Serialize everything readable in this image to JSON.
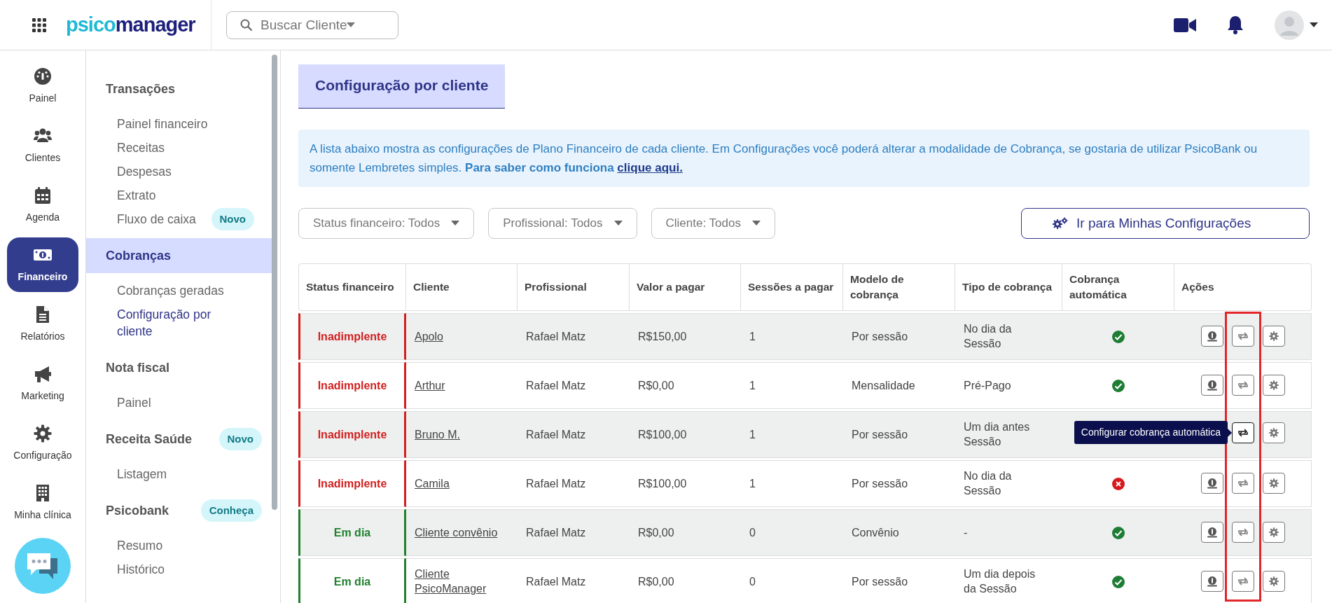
{
  "topbar": {
    "logo": [
      "psico",
      "manager"
    ],
    "search": {
      "placeholder": "Buscar Cliente"
    }
  },
  "rail": [
    {
      "label": "Painel",
      "selected": false
    },
    {
      "label": "Clientes",
      "selected": false
    },
    {
      "label": "Agenda",
      "selected": false
    },
    {
      "label": "Financeiro",
      "selected": true
    },
    {
      "label": "Relatórios",
      "selected": false
    },
    {
      "label": "Marketing",
      "selected": false
    },
    {
      "label": "Configuração",
      "selected": false
    },
    {
      "label": "Minha clínica",
      "selected": false
    }
  ],
  "submenu": [
    {
      "title": "Transações",
      "selected": false,
      "items": [
        {
          "label": "Painel financeiro",
          "selected": false
        },
        {
          "label": "Receitas",
          "selected": false
        },
        {
          "label": "Despesas",
          "selected": false
        },
        {
          "label": "Extrato",
          "selected": false
        },
        {
          "label": "Fluxo de caixa",
          "badge": "Novo",
          "selected": false
        }
      ]
    },
    {
      "title": "Cobranças",
      "selected": true,
      "items": [
        {
          "label": "Cobranças geradas",
          "selected": false
        },
        {
          "label": "Configuração por cliente",
          "selected": true
        }
      ]
    },
    {
      "title": "Nota fiscal",
      "selected": false,
      "items": [
        {
          "label": "Painel",
          "selected": false
        }
      ]
    },
    {
      "title": "Receita Saúde",
      "badge": "Novo",
      "selected": false,
      "items": [
        {
          "label": "Listagem",
          "selected": false
        }
      ]
    },
    {
      "title": "Psicobank",
      "badge": "Conheça",
      "selected": false,
      "items": [
        {
          "label": "Resumo",
          "selected": false
        },
        {
          "label": "Histórico",
          "selected": false
        }
      ]
    }
  ],
  "page_title": "Configuração por cliente",
  "info": {
    "text": "A lista abaixo mostra as configurações de Plano Financeiro de cada cliente. Em Configurações você poderá alterar a modalidade de Cobrança, se gostaria de utilizar PsicoBank ou somente Lembretes simples. **Para saber como funciona**",
    "link": "clique aqui."
  },
  "filters": [
    "Status financeiro: Todos",
    "Profissional: Todos",
    "Cliente: Todos"
  ],
  "settings_button": "Ir para Minhas Configurações",
  "table": {
    "columns": [
      "Status financeiro",
      "Cliente",
      "Profissional",
      "Valor a pagar",
      "Sessões a pagar",
      "Modelo de cobrança",
      "Tipo de cobrança",
      "Cobrança automática",
      "Ações"
    ],
    "rows": [
      {
        "status": "Inadimplente",
        "kind": "overdue",
        "client": "Apolo",
        "professional": "Rafael Matz",
        "value": "R$150,00",
        "sessions": "1",
        "model": "Por sessão",
        "type": [
          "No dia da",
          "Sessão"
        ],
        "auto": true
      },
      {
        "status": "Inadimplente",
        "kind": "overdue",
        "client": "Arthur",
        "professional": "Rafael Matz",
        "value": "R$0,00",
        "sessions": "1",
        "model": "Mensalidade",
        "type": [
          "Pré-Pago"
        ],
        "auto": true
      },
      {
        "status": "Inadimplente",
        "kind": "overdue",
        "client": "Bruno M.",
        "professional": "Rafael Matz",
        "value": "R$100,00",
        "sessions": "1",
        "model": "Por sessão",
        "type": [
          "Um dia antes",
          "Sessão"
        ],
        "sync_tooltip": "Configurar cobrança automática"
      },
      {
        "status": "Inadimplente",
        "kind": "overdue",
        "client": "Camila",
        "professional": "Rafael Matz",
        "value": "R$100,00",
        "sessions": "1",
        "model": "Por sessão",
        "type": [
          "No dia da",
          "Sessão"
        ],
        "auto": false
      },
      {
        "status": "Em dia",
        "kind": "ok",
        "client": "Cliente convênio",
        "professional": "Rafael Matz",
        "value": "R$0,00",
        "sessions": "0",
        "model": "Convênio",
        "type": [
          "-"
        ],
        "auto": true
      },
      {
        "status": "Em dia",
        "kind": "ok",
        "client": "Cliente PsicoManager",
        "professional": "Rafael Matz",
        "value": "R$0,00",
        "sessions": "0",
        "model": "Por sessão",
        "type": [
          "Um dia depois",
          "da Sessão"
        ],
        "auto": true
      }
    ]
  },
  "annotation": {
    "kind": "sync-column-box"
  }
}
